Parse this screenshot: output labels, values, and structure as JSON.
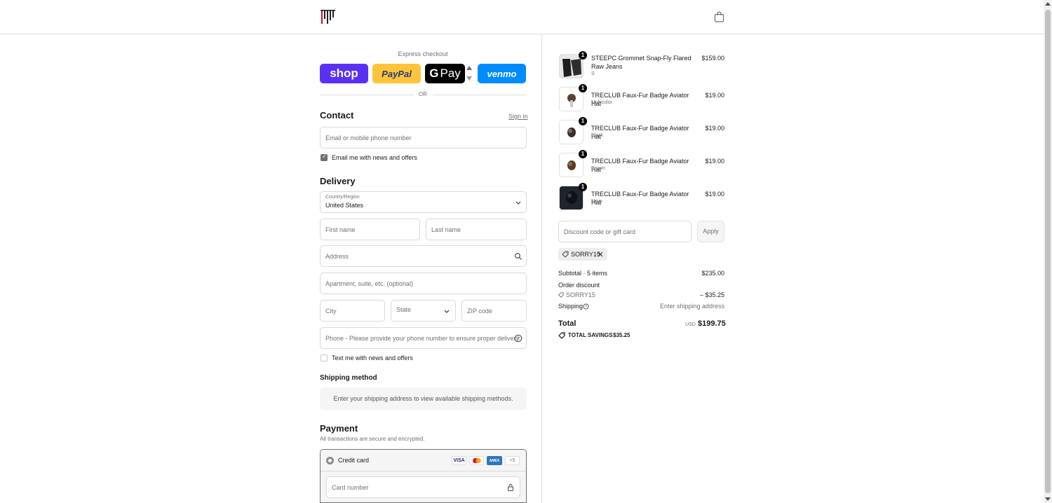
{
  "header": {
    "logo_name": "store-logo",
    "cart_icon": "shopping-bag-icon"
  },
  "express": {
    "label": "Express checkout",
    "shop_label": "shop",
    "paypal_label": "PayPal",
    "gpay_g": "G",
    "gpay_label": "Pay",
    "venmo_label": "venmo",
    "or_label": "OR"
  },
  "contact": {
    "title": "Contact",
    "sign_in": "Sign in",
    "email_placeholder": "Email or mobile phone number",
    "email_news_label": "Email me with news and offers",
    "email_news_checked": true
  },
  "delivery": {
    "title": "Delivery",
    "country_label": "Country/Region",
    "country_value": "United States",
    "first_name": "First name",
    "last_name": "Last name",
    "address": "Address",
    "apartment": "Apartment, suite, etc. (optional)",
    "city": "City",
    "state": "State",
    "zip": "ZIP code",
    "phone": "Phone - Please provide your phone number to ensure proper delivery.",
    "text_news_label": "Text me with news and offers",
    "text_news_checked": false
  },
  "shipping_method": {
    "title": "Shipping method",
    "message": "Enter your shipping address to view available shipping methods."
  },
  "payment": {
    "title": "Payment",
    "subtitle": "All transactions are secure and encrypted.",
    "credit_card_label": "Credit card",
    "cards": [
      "VISA",
      "MC",
      "AMEX"
    ],
    "more_cards": "+5",
    "card_number_placeholder": "Card number"
  },
  "order": {
    "items": [
      {
        "name": "STEEPC Grommet Snap-Fly Flared Raw Jeans",
        "variant": "S",
        "price": "$159.00",
        "qty": "1"
      },
      {
        "name": "TRECLUB Faux-Fur Badge Aviator Hat",
        "variant": "Multicolor",
        "price": "$19.00",
        "qty": "1"
      },
      {
        "name": "TRECLUB Faux-Fur Badge Aviator Hat",
        "variant": "Black",
        "price": "$19.00",
        "qty": "1"
      },
      {
        "name": "TRECLUB Faux-Fur Badge Aviator Hat",
        "variant": "Brown",
        "price": "$19.00",
        "qty": "1"
      },
      {
        "name": "TRECLUB Faux-Fur Badge Aviator Hat",
        "variant": "Navy",
        "price": "$19.00",
        "qty": "1"
      }
    ],
    "discount_placeholder": "Discount code or gift card",
    "apply_label": "Apply",
    "applied_code": "SORRY15",
    "subtotal_label": "Subtotal · 5 items",
    "subtotal_value": "$235.00",
    "order_discount_label": "Order discount",
    "discount_code": "SORRY15",
    "discount_value": "– $35.25",
    "shipping_label": "Shipping",
    "shipping_value": "Enter shipping address",
    "total_label": "Total",
    "currency": "USD",
    "total_value": "$199.75",
    "savings_label": "TOTAL SAVINGS",
    "savings_value": "$35.25"
  },
  "colors": {
    "shop": "#5a31f4",
    "paypal": "#ffc439",
    "gpay": "#000000",
    "venmo": "#008cff"
  }
}
